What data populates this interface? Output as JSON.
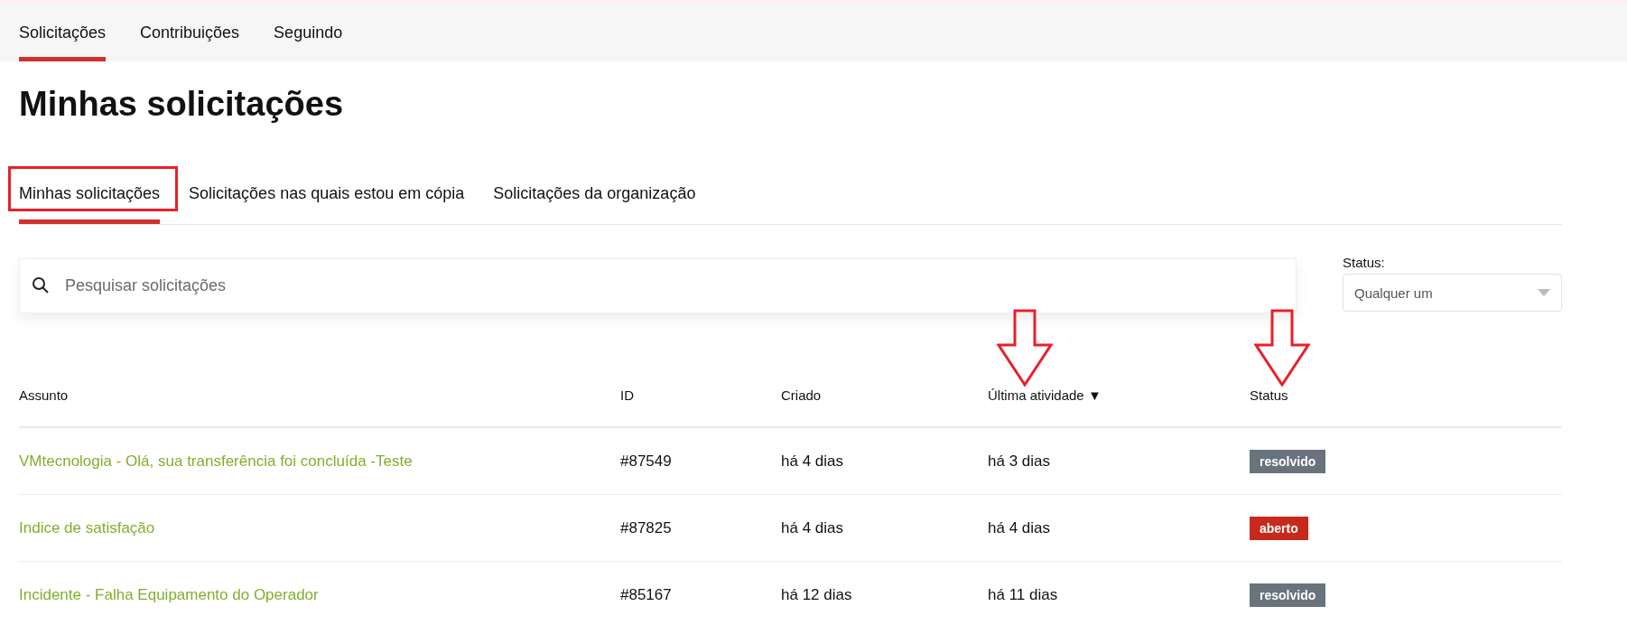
{
  "top_nav": [
    {
      "label": "Solicitações",
      "selected": true
    },
    {
      "label": "Contribuições",
      "selected": false
    },
    {
      "label": "Seguindo",
      "selected": false
    }
  ],
  "title": "Minhas solicitações",
  "tabs": [
    {
      "label": "Minhas solicitações",
      "selected": true
    },
    {
      "label": "Solicitações nas quais estou em cópia",
      "selected": false
    },
    {
      "label": "Solicitações da organização",
      "selected": false
    }
  ],
  "search": {
    "placeholder": "Pesquisar solicitações"
  },
  "status_filter": {
    "label": "Status:",
    "value": "Qualquer um"
  },
  "table": {
    "columns": [
      {
        "label": "Assunto"
      },
      {
        "label": "ID"
      },
      {
        "label": "Criado"
      },
      {
        "label": "Última atividade",
        "sort_indicator": "▼"
      },
      {
        "label": "Status"
      }
    ],
    "rows": [
      {
        "subject": "VMtecnologia - Olá, sua transferência foi concluída -Teste",
        "id": "#87549",
        "created": "há 4 dias",
        "last_activity": "há 3 dias",
        "status": {
          "label": "resolvido",
          "color": "#68737d"
        }
      },
      {
        "subject": "Indice de satisfação",
        "id": "#87825",
        "created": "há 4 dias",
        "last_activity": "há 4 dias",
        "status": {
          "label": "aberto",
          "color": "#c72a1c"
        }
      },
      {
        "subject": "Incidente - Falha Equipamento do Operador",
        "id": "#85167",
        "created": "há 12 dias",
        "last_activity": "há 11 dias",
        "status": {
          "label": "resolvido",
          "color": "#68737d"
        }
      }
    ]
  }
}
